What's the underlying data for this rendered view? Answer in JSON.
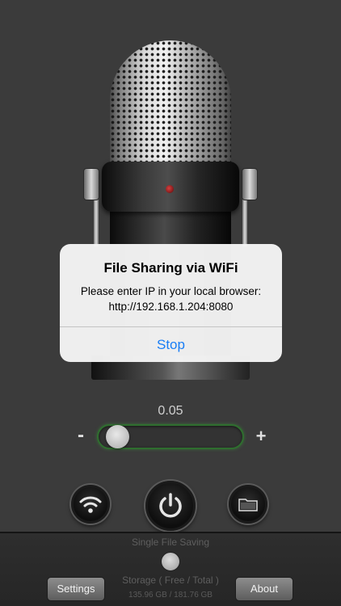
{
  "alert": {
    "title": "File Sharing via WiFi",
    "message_line1": "Please enter IP in your local browser:",
    "message_line2": "http://192.168.1.204:8080",
    "button": "Stop"
  },
  "slider": {
    "value_text": "0.05",
    "level_fraction": 0.05,
    "minus": "-",
    "plus": "+"
  },
  "controls": {
    "wifi_icon": "wifi-icon",
    "power_icon": "power-icon",
    "folder_icon": "folder-icon"
  },
  "bottom": {
    "single_file_saving": "Single File Saving",
    "storage_label": "Storage ( Free / Total )",
    "storage_value": "135.96 GB / 181.76 GB",
    "settings": "Settings",
    "about": "About"
  },
  "colors": {
    "alert_button": "#1a7ef5",
    "slider_glow": "#2f6e2f"
  }
}
